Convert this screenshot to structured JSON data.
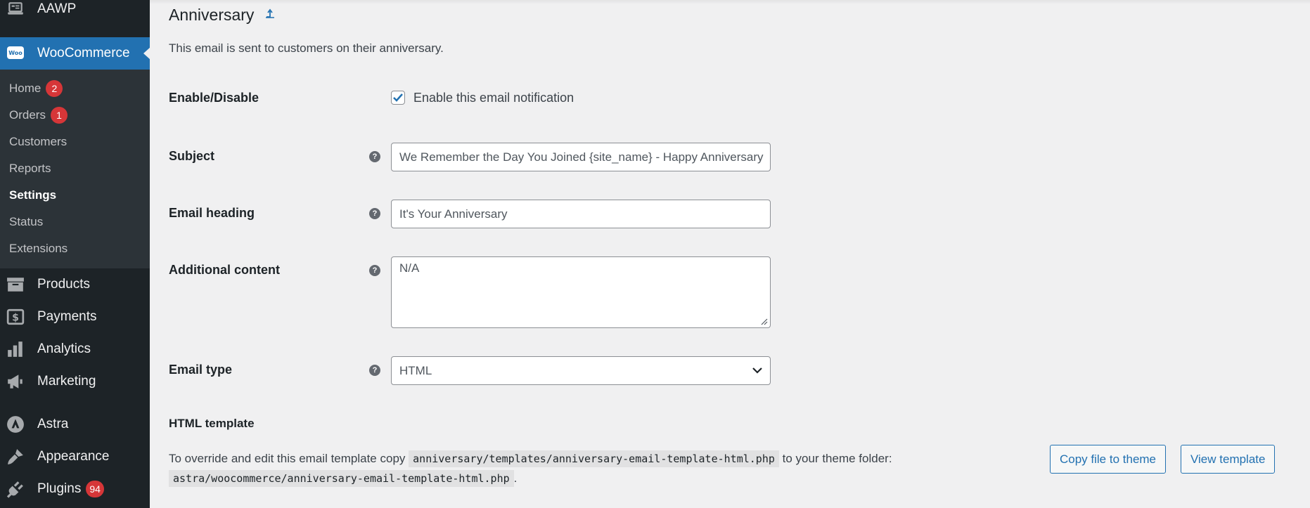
{
  "sidebar": {
    "aawp": "AAWP",
    "woocommerce": "WooCommerce",
    "submenu": [
      {
        "label": "Home",
        "badge": "2"
      },
      {
        "label": "Orders",
        "badge": "1"
      },
      {
        "label": "Customers"
      },
      {
        "label": "Reports"
      },
      {
        "label": "Settings"
      },
      {
        "label": "Status"
      },
      {
        "label": "Extensions"
      }
    ],
    "products": "Products",
    "payments": "Payments",
    "analytics": "Analytics",
    "marketing": "Marketing",
    "astra": "Astra",
    "appearance": "Appearance",
    "plugins": "Plugins",
    "plugins_badge": "94"
  },
  "main": {
    "title": "Anniversary",
    "description": "This email is sent to customers on their anniversary.",
    "enable_label": "Enable/Disable",
    "enable_checkbox_label": "Enable this email notification",
    "enable_checked": true,
    "subject_label": "Subject",
    "subject_value": "We Remember the Day You Joined {site_name} - Happy Anniversary",
    "heading_label": "Email heading",
    "heading_value": "It's Your Anniversary",
    "additional_label": "Additional content",
    "additional_value": "N/A",
    "type_label": "Email type",
    "type_value": "HTML",
    "template_section": "HTML template",
    "override_text_1": "To override and edit this email template copy",
    "override_path_1": "anniversary/templates/anniversary-email-template-html.php",
    "override_text_2": "to your theme folder:",
    "override_path_2": "astra/woocommerce/anniversary-email-template-html.php",
    "override_text_3": ".",
    "copy_button": "Copy file to theme",
    "view_button": "View template"
  }
}
